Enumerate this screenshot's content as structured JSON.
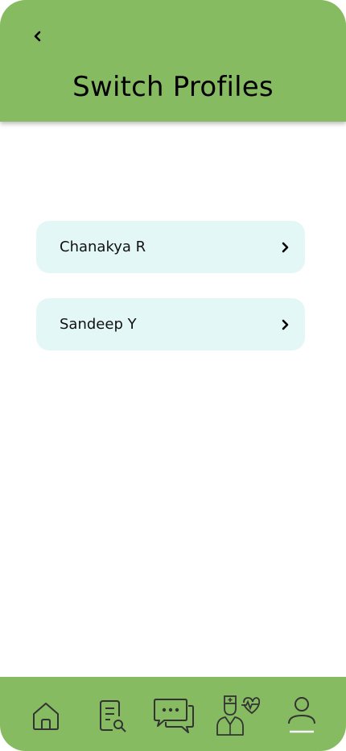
{
  "header": {
    "title": "Switch Profiles",
    "back_icon": "chevron-left-icon"
  },
  "profiles": [
    {
      "name": "Chanakya R",
      "icon": "chevron-right-icon"
    },
    {
      "name": "Sandeep Y",
      "icon": "chevron-right-icon"
    }
  ],
  "bottom_nav": {
    "items": [
      {
        "icon": "home-icon"
      },
      {
        "icon": "document-search-icon"
      },
      {
        "icon": "chat-icon"
      },
      {
        "icon": "doctor-heartbeat-icon"
      },
      {
        "icon": "profile-icon",
        "active": true
      }
    ]
  },
  "colors": {
    "primary": "#86bb62",
    "card": "#e3f8f6"
  }
}
